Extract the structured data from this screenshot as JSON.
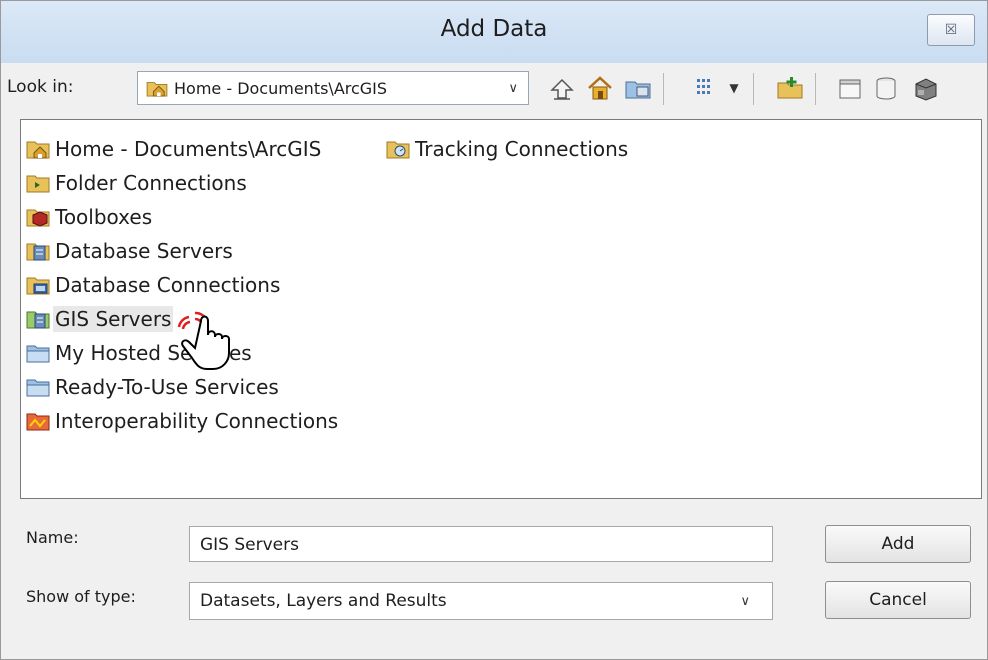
{
  "window": {
    "title": "Add Data",
    "close_glyph": "☒"
  },
  "toolbar": {
    "lookin_label": "Look in:",
    "lookin_value": "Home - Documents\\ArcGIS",
    "buttons": [
      "up-one-level",
      "home",
      "connect-to-folder",
      "view-menu",
      "new-folder",
      "new-file-geodatabase",
      "new-shapefile",
      "new-toolbox"
    ]
  },
  "items": [
    {
      "label": "Home - Documents\\ArcGIS",
      "icon": "home-folder-icon"
    },
    {
      "label": "Folder Connections",
      "icon": "folder-connections-icon"
    },
    {
      "label": "Toolboxes",
      "icon": "toolboxes-icon"
    },
    {
      "label": "Database Servers",
      "icon": "database-servers-icon"
    },
    {
      "label": "Database Connections",
      "icon": "database-connections-icon"
    },
    {
      "label": "GIS Servers",
      "icon": "gis-servers-icon"
    },
    {
      "label": "My Hosted Services",
      "icon": "hosted-services-icon"
    },
    {
      "label": "Ready-To-Use Services",
      "icon": "ready-to-use-services-icon"
    },
    {
      "label": "Interoperability Connections",
      "icon": "interoperability-icon"
    },
    {
      "label": "Tracking Connections",
      "icon": "tracking-connections-icon"
    }
  ],
  "form": {
    "name_label": "Name:",
    "name_value": "GIS Servers",
    "type_label": "Show of type:",
    "type_value": "Datasets, Layers and Results",
    "add_label": "Add",
    "cancel_label": "Cancel"
  },
  "colors": {
    "titlebar": "#c9dcf1",
    "dialog": "#f0f0f0",
    "folder": "#e8c15a",
    "cursor_accent": "#e02020"
  }
}
